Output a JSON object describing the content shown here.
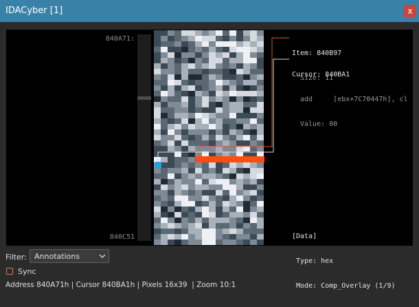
{
  "window": {
    "title": "IDACyber [1]",
    "close_label": "x"
  },
  "view": {
    "addr_top": "840A71:",
    "addr_bottom": "840C51",
    "pixel_colors": [
      "#202a33",
      "#3c4a55",
      "#5a6874",
      "#7e8a95",
      "#a8b1ba",
      "#d4dae0",
      "#eef0f4"
    ],
    "pixel_levels": [
      [
        1,
        1,
        3,
        2,
        5,
        5,
        4,
        3,
        4,
        6,
        2,
        6,
        1,
        4,
        5,
        3
      ],
      [
        1,
        3,
        1,
        2,
        3,
        4,
        6,
        5,
        5,
        2,
        1,
        3,
        1,
        3,
        5,
        4
      ],
      [
        1,
        2,
        2,
        3,
        1,
        2,
        4,
        6,
        3,
        6,
        6,
        6,
        4,
        5,
        4,
        5
      ],
      [
        2,
        6,
        1,
        1,
        0,
        2,
        3,
        2,
        4,
        2,
        1,
        5,
        6,
        6,
        5,
        4
      ],
      [
        1,
        3,
        5,
        0,
        3,
        3,
        1,
        3,
        5,
        4,
        5,
        1,
        4,
        6,
        3,
        2
      ],
      [
        1,
        4,
        3,
        1,
        2,
        0,
        3,
        2,
        5,
        5,
        2,
        4,
        4,
        6,
        6,
        1
      ],
      [
        4,
        1,
        3,
        2,
        4,
        5,
        3,
        4,
        5,
        3,
        2,
        3,
        1,
        4,
        3,
        1
      ],
      [
        5,
        3,
        3,
        2,
        4,
        2,
        2,
        1,
        2,
        2,
        1,
        0,
        5,
        4,
        2,
        2
      ],
      [
        3,
        2,
        5,
        0,
        4,
        0,
        0,
        2,
        4,
        3,
        1,
        1,
        2,
        0,
        3,
        4
      ],
      [
        2,
        2,
        6,
        5,
        2,
        1,
        2,
        2,
        3,
        6,
        4,
        3,
        2,
        4,
        4,
        2
      ],
      [
        3,
        1,
        4,
        1,
        4,
        5,
        1,
        2,
        3,
        4,
        1,
        4,
        1,
        0,
        1,
        3
      ],
      [
        2,
        6,
        4,
        2,
        1,
        0,
        4,
        3,
        1,
        5,
        4,
        6,
        5,
        5,
        5,
        4
      ],
      [
        0,
        3,
        2,
        2,
        5,
        1,
        3,
        5,
        3,
        4,
        3,
        0,
        3,
        0,
        1,
        2
      ],
      [
        4,
        1,
        3,
        3,
        4,
        1,
        3,
        5,
        1,
        0,
        3,
        4,
        4,
        2,
        2,
        5
      ],
      [
        5,
        2,
        2,
        3,
        3,
        1,
        2,
        1,
        1,
        5,
        3,
        4,
        4,
        0,
        5,
        5
      ],
      [
        5,
        0,
        2,
        4,
        4,
        3,
        6,
        5,
        4,
        3,
        3,
        6,
        1,
        1,
        1,
        3
      ],
      [
        4,
        2,
        1,
        2,
        5,
        0,
        4,
        6,
        3,
        4,
        2,
        2,
        3,
        3,
        6,
        2
      ],
      [
        6,
        2,
        4,
        5,
        3,
        5,
        4,
        4,
        6,
        4,
        1,
        2,
        0,
        4,
        3,
        4
      ],
      [
        4,
        1,
        6,
        3,
        1,
        3,
        3,
        3,
        1,
        3,
        1,
        4,
        3,
        1,
        0,
        4
      ],
      [
        5,
        3,
        3,
        5,
        2,
        1,
        2,
        4,
        2,
        5,
        3,
        2,
        4,
        6,
        2,
        5
      ],
      [
        2,
        3,
        5,
        1,
        5,
        2,
        2,
        2,
        1,
        3,
        4,
        3,
        1,
        1,
        3,
        2
      ],
      [
        1,
        1,
        4,
        3,
        1,
        4,
        3,
        3,
        3,
        4,
        3,
        3,
        5,
        6,
        2,
        3
      ],
      [
        1,
        1,
        1,
        6,
        1,
        0,
        3,
        6,
        1,
        3,
        4,
        3,
        6,
        1,
        1,
        6
      ],
      [
        6,
        4,
        1,
        2,
        2,
        3,
        2,
        5,
        5,
        2,
        2,
        3,
        6,
        6,
        3,
        2
      ],
      [
        3,
        1,
        1,
        2,
        3,
        2,
        3,
        2,
        5,
        1,
        2,
        5,
        4,
        5,
        4,
        3
      ],
      [
        3,
        2,
        3,
        3,
        4,
        1,
        5,
        2,
        3,
        1,
        5,
        4,
        1,
        0,
        5,
        5
      ],
      [
        2,
        2,
        6,
        1,
        3,
        4,
        3,
        4,
        4,
        3,
        2,
        0,
        5,
        4,
        5,
        6
      ],
      [
        4,
        0,
        2,
        4,
        3,
        3,
        6,
        2,
        5,
        6,
        6,
        3,
        4,
        3,
        4,
        1
      ],
      [
        1,
        5,
        3,
        4,
        5,
        3,
        4,
        4,
        3,
        3,
        6,
        6,
        4,
        1,
        1,
        3
      ],
      [
        3,
        3,
        1,
        4,
        3,
        2,
        3,
        1,
        1,
        5,
        2,
        6,
        3,
        4,
        5,
        1
      ],
      [
        2,
        3,
        2,
        6,
        6,
        3,
        3,
        5,
        3,
        2,
        1,
        4,
        6,
        3,
        1,
        2
      ],
      [
        3,
        2,
        1,
        4,
        6,
        6,
        1,
        2,
        4,
        2,
        5,
        4,
        3,
        0,
        2,
        6
      ],
      [
        5,
        0,
        3,
        0,
        2,
        1,
        4,
        6,
        4,
        1,
        4,
        2,
        6,
        0,
        3,
        4
      ],
      [
        4,
        1,
        0,
        5,
        1,
        2,
        1,
        6,
        5,
        1,
        2,
        4,
        4,
        3,
        5,
        2
      ],
      [
        2,
        6,
        3,
        0,
        3,
        2,
        4,
        2,
        4,
        4,
        4,
        3,
        2,
        0,
        6,
        4
      ],
      [
        3,
        4,
        5,
        4,
        3,
        4,
        5,
        1,
        4,
        2,
        2,
        3,
        1,
        3,
        2,
        4
      ],
      [
        1,
        2,
        2,
        1,
        2,
        4,
        4,
        6,
        6,
        3,
        4,
        5,
        4,
        2,
        2,
        2
      ],
      [
        2,
        4,
        5,
        4,
        6,
        3,
        4,
        6,
        6,
        3,
        2,
        1,
        3,
        3,
        1,
        4
      ],
      [
        3,
        4,
        1,
        0,
        2,
        3,
        3,
        6,
        6,
        2,
        3,
        3,
        2,
        1,
        3,
        1
      ]
    ],
    "highlight_color": "#ff4d11",
    "cursor_color": "#19a6e8",
    "leader_item_color": "#e8542a",
    "leader_cursor_color": "#dcdcdc"
  },
  "item": {
    "label": "Item:",
    "address": "840B97",
    "size_label": "Size:",
    "size_value": "11"
  },
  "cursor": {
    "label": "Cursor:",
    "address": "840BA1",
    "mnemonic": "add",
    "operands": "[ebx+7C70447h], cl",
    "value_label": "Value:",
    "value": "00"
  },
  "data_block": {
    "header": "[Data]",
    "type_label": "Type:",
    "type_value": "hex",
    "mode_label": "Mode:",
    "mode_value": "Comp_Overlay (1/9)"
  },
  "filter": {
    "label": "Filter:",
    "selected": "Annotations"
  },
  "sync": {
    "label": "Sync",
    "checked": false,
    "accent": "#e67b52"
  },
  "status": {
    "address_label": "Address",
    "address": "840A71h",
    "cursor_label": "Cursor",
    "cursor": "840BA1h",
    "pixels_label": "Pixels",
    "pixels": "16x39",
    "zoom_label": "Zoom",
    "zoom": "10:1"
  }
}
